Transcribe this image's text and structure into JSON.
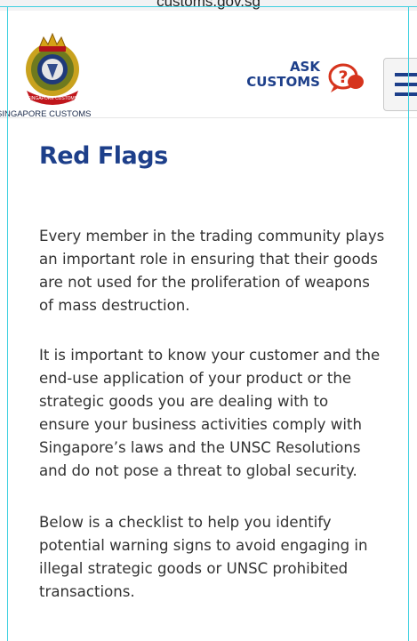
{
  "browser": {
    "url": "customs.gov.sg"
  },
  "header": {
    "logo_caption": "SINGAPORE CUSTOMS",
    "ask_line1": "ASK",
    "ask_line2": "CUSTOMS",
    "ask_icon_glyph": "?"
  },
  "main": {
    "title": "Red Flags",
    "paragraphs": [
      {
        "lines": [
          "Every member in the trading community plays",
          "an important role in ensuring that their goods",
          "are not used for the proliferation of weapons",
          "of mass destruction."
        ]
      },
      {
        "lines": [
          "It is important to know your customer and the",
          "end-use application of your product or the",
          "strategic goods you are dealing with to",
          "ensure your business activities comply with",
          "Singapore’s laws and the UNSC Resolutions",
          "and do not pose a threat to global security."
        ]
      },
      {
        "lines": [
          "Below is a checklist to help you identify",
          "potential warning signs to avoid engaging in",
          "illegal strategic goods or UNSC prohibited",
          "transactions."
        ]
      }
    ]
  },
  "colors": {
    "brand_blue": "#1d3f8a",
    "ask_icon_red": "#d6341d",
    "body_text": "#333333",
    "selection_cyan": "#3fd0e0"
  },
  "icons": {
    "logo": "singapore-customs-crest-icon",
    "ask": "question-speech-bubble-icon",
    "menu": "hamburger-menu-icon"
  }
}
